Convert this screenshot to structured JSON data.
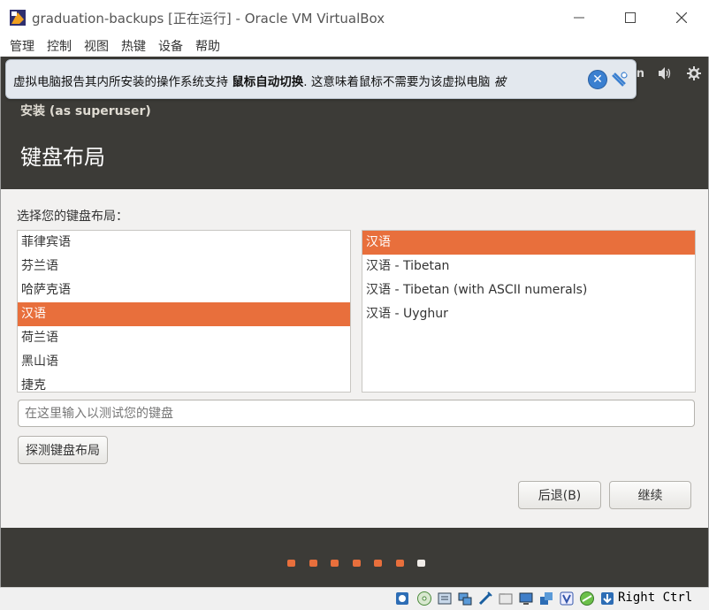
{
  "window": {
    "title": "graduation-backups [正在运行] - Oracle VM VirtualBox"
  },
  "menubar": {
    "items": [
      "管理",
      "控制",
      "视图",
      "热键",
      "设备",
      "帮助"
    ]
  },
  "notification": {
    "text_prefix": "虚拟电脑报告其内所安装的操作系统支持 ",
    "text_bold": "鼠标自动切换",
    "text_suffix": ". 这意味着鼠标不需要为该虚拟电脑 ",
    "text_clipped": "被",
    "close_icon": "close-icon",
    "pin_icon": "pin-icon"
  },
  "ubuntu_topbar": {
    "keyboard_indicator": "En",
    "icons": [
      "accessibility-icon",
      "keyboard-icon",
      "volume-icon",
      "settings-icon"
    ]
  },
  "installer": {
    "title": "安装 (as superuser)",
    "heading": "键盘布局",
    "prompt": "选择您的键盘布局：",
    "layouts": [
      "菲律宾语",
      "芬兰语",
      "哈萨克语",
      "汉语",
      "荷兰语",
      "黑山语",
      "捷克"
    ],
    "selected_layout": "汉语",
    "variants": [
      "汉语",
      "汉语 - Tibetan",
      "汉语 - Tibetan (with ASCII numerals)",
      "汉语 - Uyghur"
    ],
    "selected_variant": "汉语",
    "test_placeholder": "在这里输入以测试您的键盘",
    "detect_button": "探测键盘布局",
    "back_button": "后退(B)",
    "continue_button": "继续",
    "progress": {
      "total_steps": 7,
      "current_step": 7
    }
  },
  "statusbar": {
    "host_key": "Right Ctrl",
    "icons": [
      "hard-disk-icon",
      "optical-disk-icon",
      "audio-icon",
      "network-icon",
      "usb-icon",
      "shared-folder-icon",
      "display-icon",
      "video-capture-icon",
      "recording-icon",
      "virtualization-icon",
      "mouse-integration-icon",
      "host-key-arrow-icon"
    ]
  },
  "colors": {
    "ubuntu_orange": "#e86f3c",
    "ubuntu_dark": "#3c3b37",
    "installer_bg": "#f2f1f0"
  }
}
